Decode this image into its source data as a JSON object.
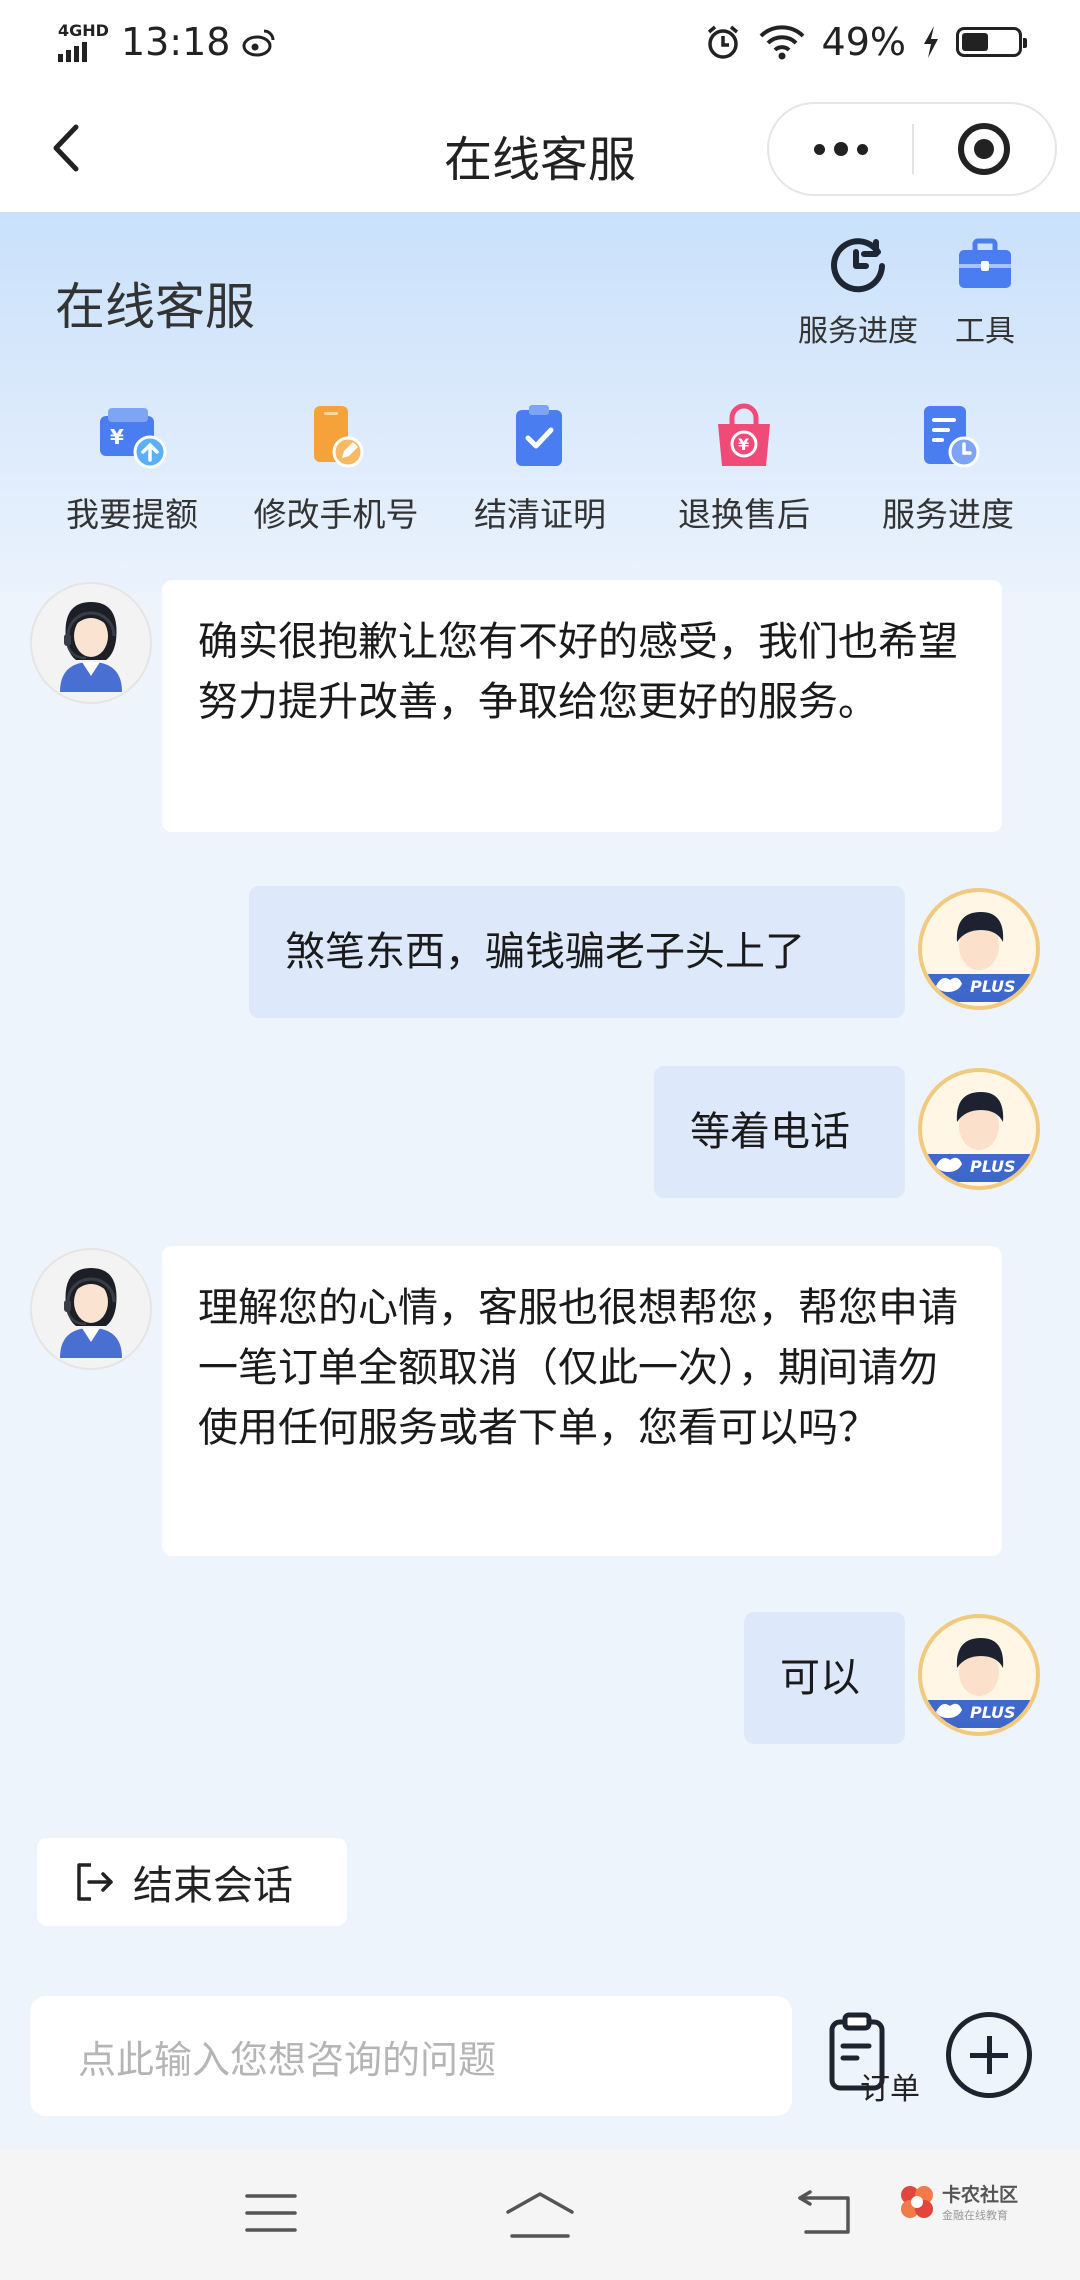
{
  "status_bar": {
    "network": "4G",
    "network_hd": "HD",
    "time": "13:18",
    "battery_percent": "49%",
    "battery_level": 0.49,
    "icons": [
      "weibo-icon",
      "alarm-icon",
      "wifi-icon",
      "charging-icon",
      "battery-icon"
    ]
  },
  "nav": {
    "title": "在线客服",
    "back_icon": "chevron-left-icon",
    "more_icon": "more-dots-icon",
    "target_icon": "target-circle-icon"
  },
  "panel": {
    "title": "在线客服",
    "top_tools": [
      {
        "label": "服务进度",
        "icon": "clock-icon"
      },
      {
        "label": "工具",
        "icon": "toolbox-icon"
      }
    ],
    "shortcuts": [
      {
        "label": "我要提额",
        "icon": "wallet-up-icon"
      },
      {
        "label": "修改手机号",
        "icon": "phone-edit-icon"
      },
      {
        "label": "结清证明",
        "icon": "clipboard-check-icon"
      },
      {
        "label": "退换售后",
        "icon": "refund-bag-icon"
      },
      {
        "label": "服务进度",
        "icon": "document-clock-icon"
      }
    ]
  },
  "messages": [
    {
      "sender": "agent",
      "text": "确实很抱歉让您有不好的感受，我们也希望努力提升改善，争取给您更好的服务。"
    },
    {
      "sender": "user",
      "text": "煞笔东西，骗钱骗老子头上了"
    },
    {
      "sender": "user",
      "text": "等着电话"
    },
    {
      "sender": "agent",
      "text": "理解您的心情，客服也很想帮您，帮您申请一笔订单全额取消（仅此一次），期间请勿使用任何服务或者下单，您看可以吗？"
    },
    {
      "sender": "user",
      "text": "可以"
    }
  ],
  "user_badge": "PLUS",
  "end_session": {
    "label": "结束会话",
    "icon": "logout-icon"
  },
  "composer": {
    "placeholder": "点此输入您想咨询的问题",
    "order_label": "订单",
    "order_icon": "clipboard-icon",
    "plus_icon": "plus-circle-icon"
  },
  "system_nav": {
    "menu_icon": "menu-icon",
    "home_icon": "home-icon",
    "back_icon": "back-arrow-icon",
    "watermark_title": "卡农社区",
    "watermark_sub": "金融在线教育"
  },
  "colors": {
    "accent_blue": "#4a7ef0",
    "user_bubble": "#dde8fb",
    "agent_bubble": "#ffffff",
    "orange": "#f5a23a",
    "pink": "#ef4a78"
  }
}
